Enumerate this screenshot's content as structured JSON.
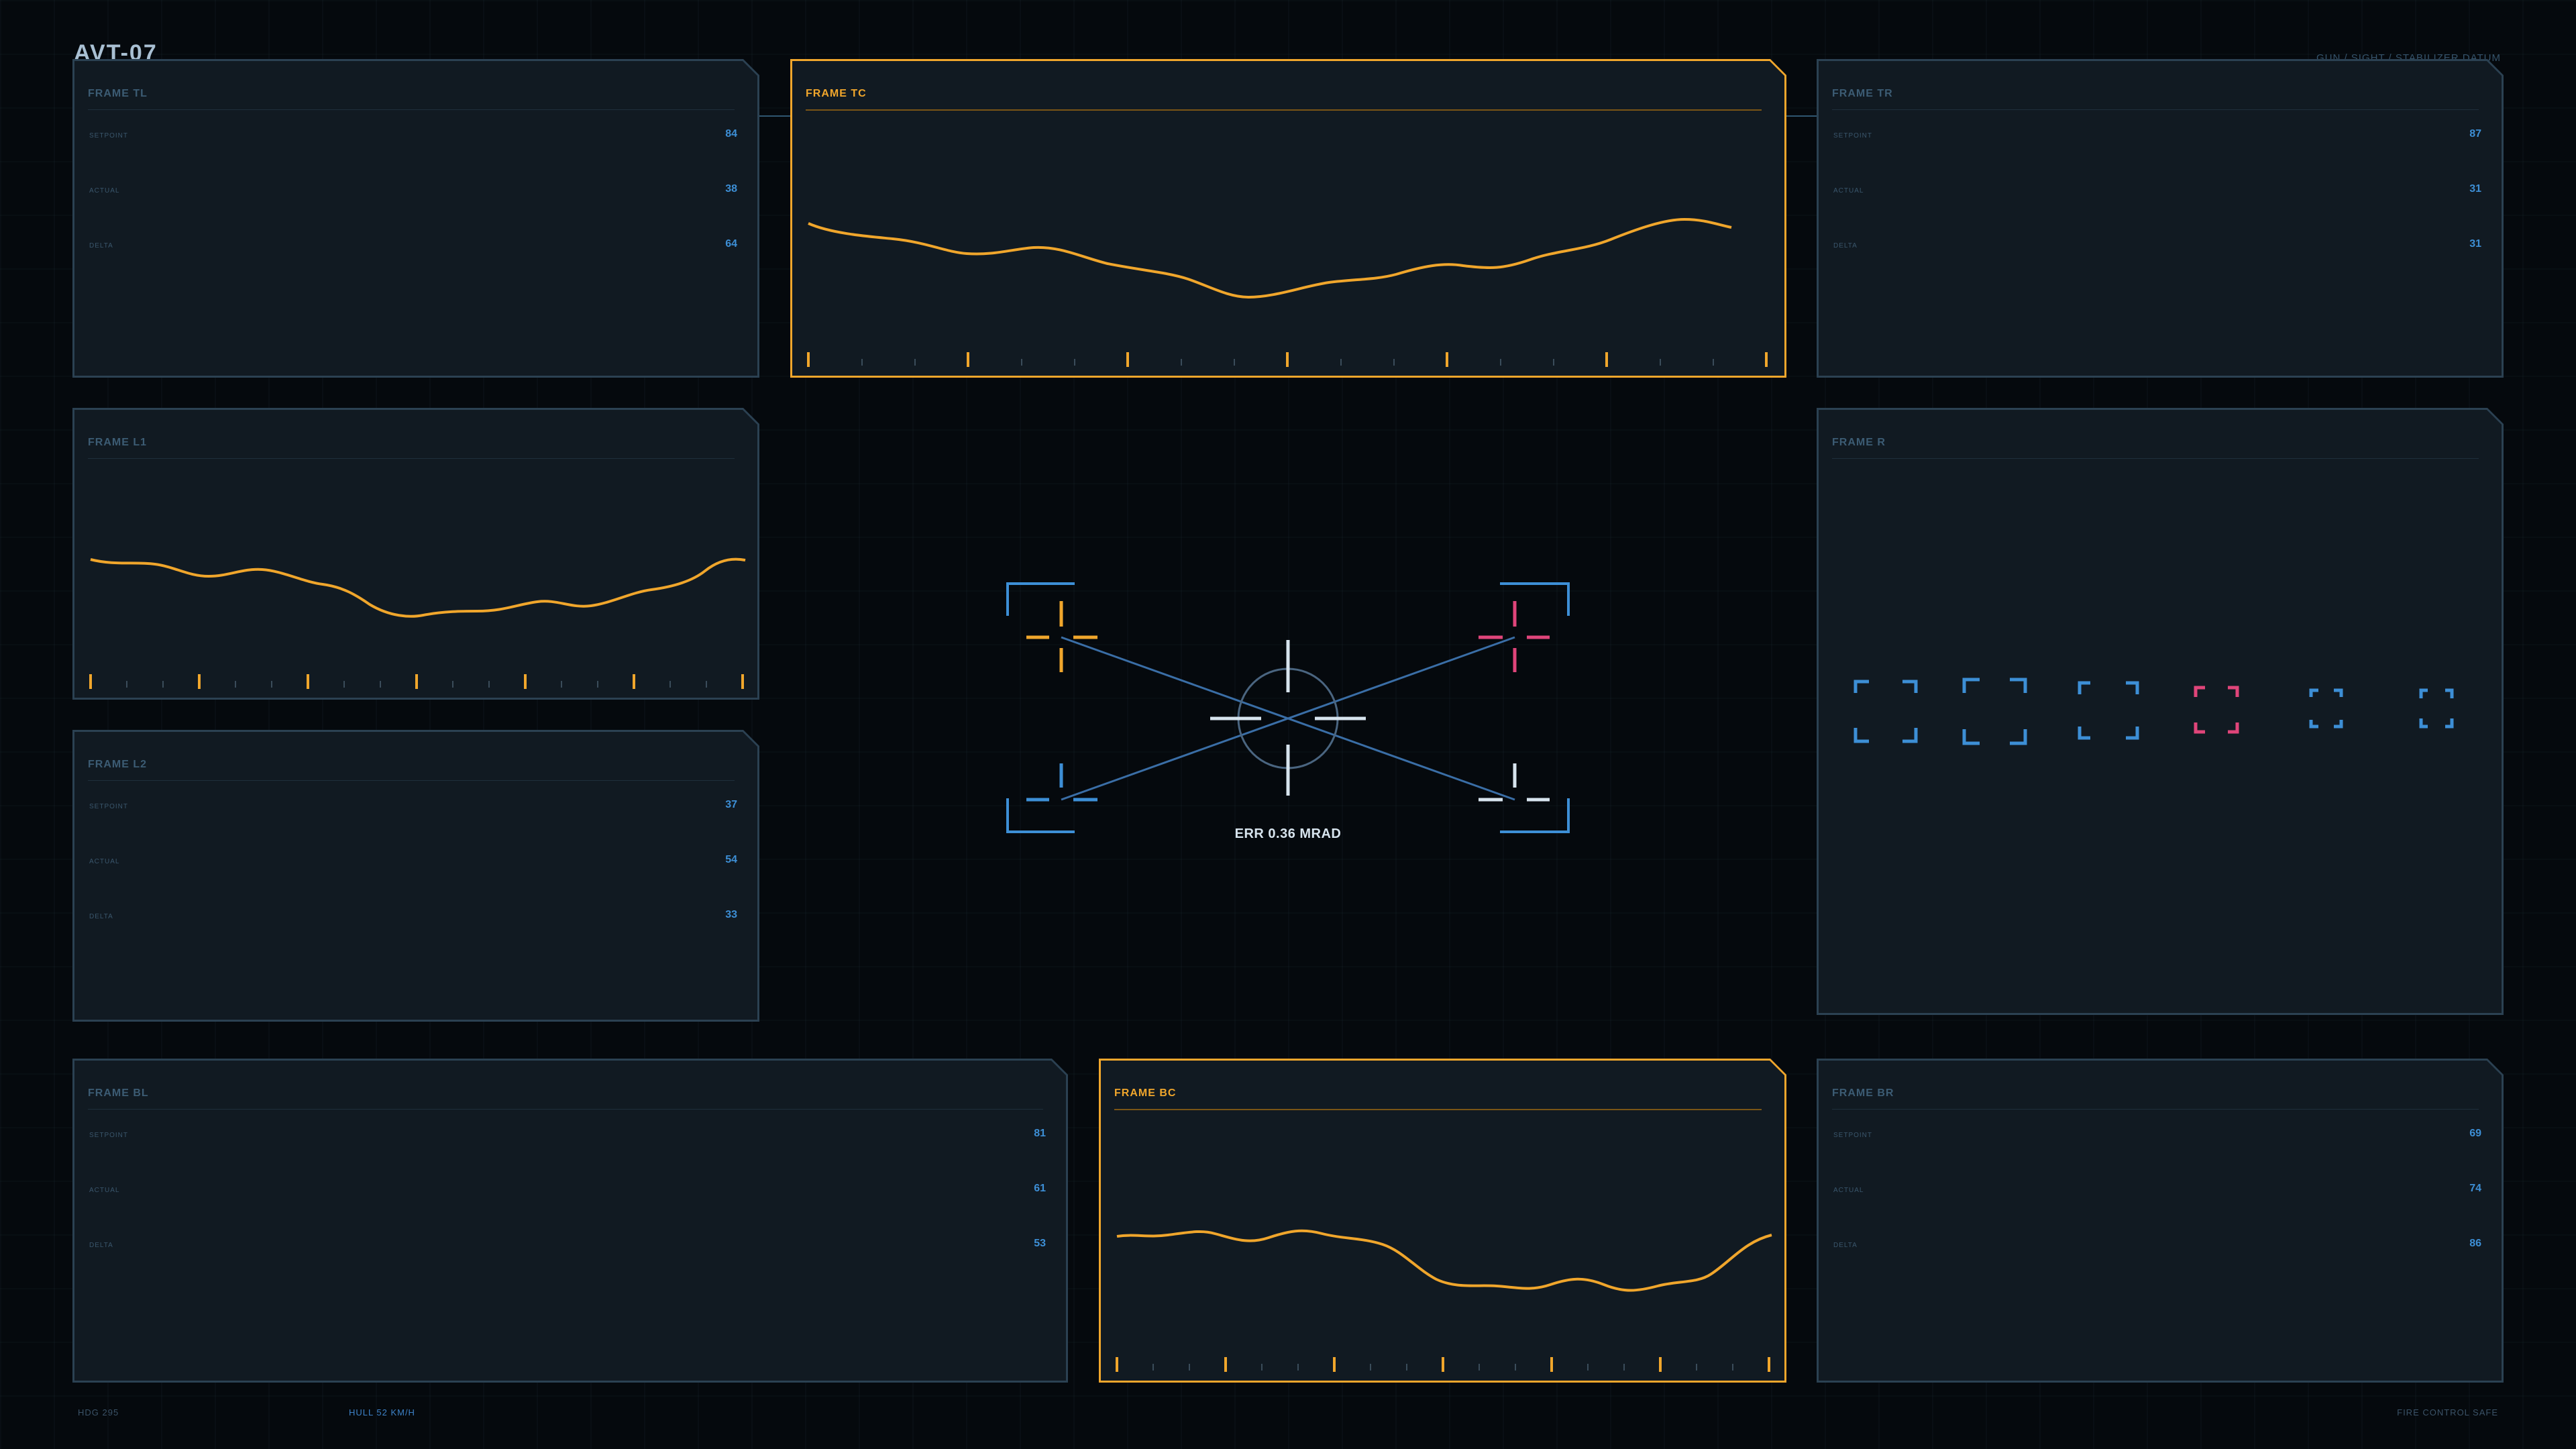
{
  "app": {
    "title": "AVT-07",
    "subtitle": "GUN / SIGHT / STABILIZER DATUM"
  },
  "colors": {
    "accent": "#f0a62c",
    "frame_border": "#2b4152",
    "value_blue": "#3d8fd6",
    "target_magenta": "#e0457a",
    "reticle_white": "#d7e4ee"
  },
  "frames": {
    "tl": {
      "title": "FRAME TL",
      "stats": [
        {
          "label": "SETPOINT",
          "value": "84"
        },
        {
          "label": "ACTUAL",
          "value": "38"
        },
        {
          "label": "DELTA",
          "value": "64"
        }
      ]
    },
    "tc": {
      "title": "FRAME TC"
    },
    "tr": {
      "title": "FRAME TR",
      "stats": [
        {
          "label": "SETPOINT",
          "value": "87"
        },
        {
          "label": "ACTUAL",
          "value": "31"
        },
        {
          "label": "DELTA",
          "value": "31"
        }
      ]
    },
    "l1": {
      "title": "FRAME L1"
    },
    "l2": {
      "title": "FRAME L2",
      "stats": [
        {
          "label": "SETPOINT",
          "value": "37"
        },
        {
          "label": "ACTUAL",
          "value": "54"
        },
        {
          "label": "DELTA",
          "value": "33"
        }
      ]
    },
    "r": {
      "title": "FRAME R"
    },
    "bl": {
      "title": "FRAME BL",
      "stats": [
        {
          "label": "SETPOINT",
          "value": "81"
        },
        {
          "label": "ACTUAL",
          "value": "61"
        },
        {
          "label": "DELTA",
          "value": "53"
        }
      ]
    },
    "bc": {
      "title": "FRAME BC"
    },
    "br": {
      "title": "FRAME BR",
      "stats": [
        {
          "label": "SETPOINT",
          "value": "69"
        },
        {
          "label": "ACTUAL",
          "value": "74"
        },
        {
          "label": "DELTA",
          "value": "86"
        }
      ]
    }
  },
  "reticle": {
    "error_readout": "ERR 0.36 MRAD"
  },
  "target_brackets": [
    {
      "id": "t1",
      "color": "#3d8fd6"
    },
    {
      "id": "t2",
      "color": "#3d8fd6"
    },
    {
      "id": "t3",
      "color": "#3d8fd6"
    },
    {
      "id": "t4",
      "color": "#e0457a"
    },
    {
      "id": "t5",
      "color": "#3d8fd6"
    },
    {
      "id": "t6",
      "color": "#3d8fd6"
    }
  ],
  "footer": {
    "heading": "HDG 295",
    "hull": "HULL 52 KM/H",
    "status": "FIRE CONTROL SAFE"
  }
}
